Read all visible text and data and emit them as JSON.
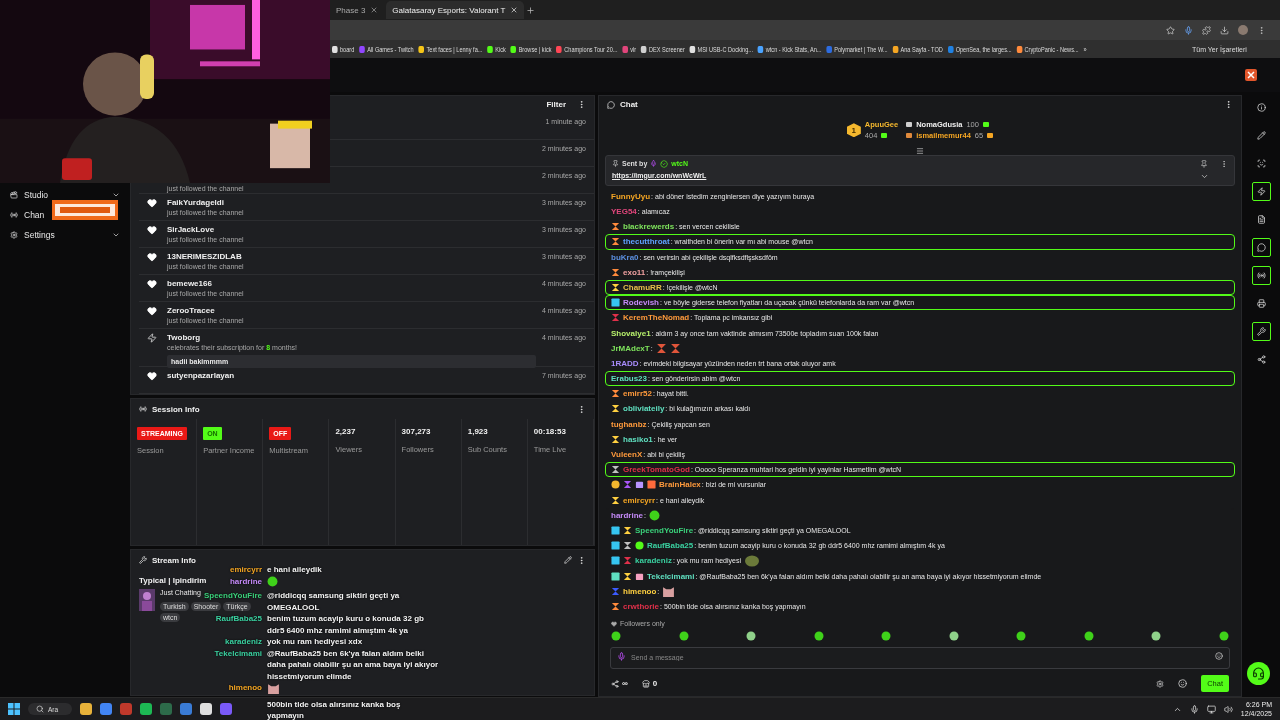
{
  "browser": {
    "tabs": [
      {
        "title": "Phase 3",
        "selected": false
      },
      {
        "title": "Galatasaray Esports: Valorant T",
        "selected": true
      }
    ],
    "bookmarks": [
      {
        "label": "board",
        "color": "#e0e0e0"
      },
      {
        "label": "All Games - Twitch",
        "color": "#9146ff"
      },
      {
        "label": "Text faces | Lenny fa...",
        "color": "#f5c518"
      },
      {
        "label": "Kick",
        "color": "#53fc18"
      },
      {
        "label": "Browse | kick",
        "color": "#53fc18"
      },
      {
        "label": "Champions Tour 20...",
        "color": "#ff4655"
      },
      {
        "label": "vlr",
        "color": "#e0457b"
      },
      {
        "label": "DEX Screener",
        "color": "#d0d0d0"
      },
      {
        "label": "MSI USB-C Docking...",
        "color": "#e0e0e0"
      },
      {
        "label": "wtcn - Kick Stats, An...",
        "color": "#4aa3ff"
      },
      {
        "label": "Polymarket | The W...",
        "color": "#2d6cdf"
      },
      {
        "label": "Ana Sayfa - TOD",
        "color": "#f5a623"
      },
      {
        "label": "OpenSea, the larges...",
        "color": "#2081e2"
      },
      {
        "label": "CryptoPanic - News...",
        "color": "#ff8a3c"
      }
    ],
    "bookmarks_more": "»",
    "all_bookmarks": "Tüm Yer İşaretleri"
  },
  "sidebar": {
    "items": [
      {
        "label": "Studio",
        "expandable": true
      },
      {
        "label": "Chan",
        "expandable": false
      },
      {
        "label": "Settings",
        "expandable": true
      }
    ]
  },
  "activity": {
    "filter": "Filter",
    "items": [
      {
        "time": "1 minute ago"
      },
      {
        "time": "2 minutes ago"
      },
      {
        "subtitle": "just followed the channel",
        "time": "2 minutes ago"
      },
      {
        "kind": "follow",
        "name": "FaikYurdageldi",
        "subtitle": "just followed the channel",
        "time": "3 minutes ago"
      },
      {
        "kind": "follow",
        "name": "SirJackLove",
        "subtitle": "just followed the channel",
        "time": "3 minutes ago"
      },
      {
        "kind": "follow",
        "name": "13NERIMESZIDLAB",
        "subtitle": "just followed the channel",
        "time": "3 minutes ago"
      },
      {
        "kind": "follow",
        "name": "bemewe166",
        "subtitle": "just followed the channel",
        "time": "4 minutes ago"
      },
      {
        "kind": "follow",
        "name": "ZerooTracee",
        "subtitle": "just followed the channel",
        "time": "4 minutes ago"
      },
      {
        "kind": "sub",
        "name": "Twoborg",
        "subtitle": "celebrates their subscription for ",
        "months": "8",
        "subtitle_end": " months!",
        "message": "hadii bakimmmm",
        "time": "4 minutes ago"
      },
      {
        "kind": "follow",
        "name": "sutyenpazarlayan",
        "time": "7 minutes ago"
      }
    ]
  },
  "session": {
    "title": "Session Info",
    "stats": [
      {
        "kind": "badge",
        "value": "STREAMING",
        "label": "Session",
        "color": "#e91916"
      },
      {
        "kind": "badge",
        "value": "ON",
        "label": "Partner Income",
        "color": "#53fc18"
      },
      {
        "kind": "badge",
        "value": "OFF",
        "label": "Multistream",
        "color": "#e91916"
      },
      {
        "kind": "number",
        "value": "2,237",
        "label": "Viewers"
      },
      {
        "kind": "number",
        "value": "307,273",
        "label": "Followers"
      },
      {
        "kind": "number",
        "value": "1,923",
        "label": "Sub Counts"
      },
      {
        "kind": "number",
        "value": "00:18:53",
        "label": "Time Live"
      }
    ]
  },
  "stream_info": {
    "title": "Stream Info",
    "stream_title": "Typical | Ipindirim",
    "category": "Just Chatting",
    "tags": [
      "Turkish",
      "Shooter",
      "Türkçe",
      "wtcn"
    ]
  },
  "overlay_chat": [
    {
      "name": "emircyrr",
      "color": "#f5a623",
      "text": "e hani aileydik"
    },
    {
      "name": "hardrine",
      "color": "#c58af9",
      "emotes": [
        {
          "kind": "blob"
        }
      ]
    },
    {
      "name": "SpeendYouFire",
      "color": "#3ad07a",
      "text": "@riddicqq samsung siktiri geçti ya OMEGALOOL"
    },
    {
      "name": "RaufBaba25",
      "color": "#3ad0a0",
      "text": "benim tuzum acayip kuru o konuda 32 gb ddr5 6400 mhz ramimi almıştım 4k ya"
    },
    {
      "name": "karadeniz",
      "color": "#3ad0a0",
      "text": "yok mu ram hediyesi xdx"
    },
    {
      "name": "Tekelcimami",
      "color": "#3ad0a0",
      "text": "@RaufBaba25 ben 6k'ya falan aldım belki daha pahalı olabilir şu an ama baya iyi akıyor hissetmiyorum elimde"
    },
    {
      "name": "himenoo",
      "color": "#f5a623",
      "emotes": [
        {
          "kind": "cat"
        }
      ]
    },
    {
      "text": "500bin tlde olsa alırsınız kanka boş yapmayın"
    }
  ],
  "chat": {
    "title": "Chat",
    "leaderboard": [
      {
        "rank": "1",
        "name": "ApuuGee",
        "points": "404"
      },
      {
        "name": "NomaGdusia",
        "points": "100"
      },
      {
        "name": "ismailmemur44",
        "points": "65"
      }
    ],
    "pinned": {
      "label": "Sent by",
      "user": "wtcN",
      "link": "https://imgur.com/wnWcWrL"
    },
    "messages": [
      {
        "name": "FunnyUyu",
        "color": "#f5a623",
        "text": ": abi döner istedim zenginlersen diye yazıyım buraya",
        "highlighted": false
      },
      {
        "name": "YEG54",
        "color": "#e0457b",
        "text": ": alamıcaz",
        "highlighted": false
      },
      {
        "badges": [
          {
            "kind": "sub",
            "color": "#ff8a3c"
          }
        ],
        "name": "blackrewerds",
        "color": "#7ee35c",
        "text": ": sen vercen cekilisle",
        "highlighted": false
      },
      {
        "badges": [
          {
            "kind": "sub",
            "color": "#ff8a3c"
          }
        ],
        "name": "thecutthroat",
        "color": "#5fa0ff",
        "text": ": wraithden bi önerin var mı abi mouse @wtcn",
        "highlighted": true
      },
      {
        "name": "buKra0",
        "color": "#5b8fe0",
        "text": ": sen verirsin abi çekilişle dsqlfksdflşsksdföm",
        "highlighted": false
      },
      {
        "badges": [
          {
            "kind": "sub",
            "color": "#ff8a3c"
          }
        ],
        "name": "exo11",
        "color": "#f0a0a0",
        "text": ": !ramçekilişi",
        "highlighted": false
      },
      {
        "badges": [
          {
            "kind": "sub",
            "color": "#ffd040"
          }
        ],
        "name": "ChamuRR",
        "color": "#e8c04a",
        "text": ": !çekilişle @wtcN",
        "highlighted": true
      },
      {
        "badges": [
          {
            "kind": "og",
            "color": "#36c5f0"
          }
        ],
        "name": "Rodevish",
        "color": "#c58af9",
        "text": ": ve böyle giderse telefon fiyatları da uçacak çünkü telefonlarda da ram var @wtcn",
        "highlighted": true
      },
      {
        "badges": [
          {
            "kind": "sub",
            "color": "#e0304a"
          }
        ],
        "name": "KeremTheNomad",
        "color": "#ff9a3c",
        "text": ": Toplama pc imkansız gibi",
        "highlighted": false
      },
      {
        "name": "Shovalye1",
        "color": "#b7f06c",
        "text": ": aldım 3 ay once tam vaktinde almısım 73500e topladım suan 100k falan",
        "highlighted": false
      },
      {
        "name": "JrMAdexT",
        "color": "#7ee35c",
        "text": ":",
        "emotes": [
          {
            "kind": "hourglass"
          },
          {
            "kind": "hourglass"
          }
        ],
        "highlighted": false
      },
      {
        "name": "1RADD",
        "color": "#a78bfa",
        "text": ": evimdeki bilgisayar yüzünden neden trt bana ortak oluyor amk",
        "highlighted": false
      },
      {
        "name": "Erabus23",
        "color": "#5fe0c0",
        "text": ": sen gönderirsin abim @wtcn",
        "highlighted": true
      },
      {
        "badges": [
          {
            "kind": "sub",
            "color": "#ff8a3c"
          }
        ],
        "name": "emirr52",
        "color": "#ff9a3c",
        "text": ": hayat bitti.",
        "highlighted": false
      },
      {
        "badges": [
          {
            "kind": "sub",
            "color": "#ffd040"
          }
        ],
        "name": "obliviateily",
        "color": "#5fe0c0",
        "text": ": bi kulağımızın arkası kaldı",
        "highlighted": false
      },
      {
        "name": "tughanbz",
        "color": "#ff9a3c",
        "text": ": Çekiliş yapcan sen",
        "highlighted": false
      },
      {
        "badges": [
          {
            "kind": "sub",
            "color": "#ffd040"
          }
        ],
        "name": "hasiko1",
        "color": "#5fe0c0",
        "text": ": he ver",
        "highlighted": false
      },
      {
        "name": "VuleenX",
        "color": "#ff9a3c",
        "text": ": abi bi çekiliş",
        "highlighted": false
      },
      {
        "badges": [
          {
            "kind": "sub",
            "color": "#c0c0c0"
          }
        ],
        "name": "GreekTomatoGod",
        "color": "#e0304a",
        "text": ": Ooooo Speranza muhtari hos geldin iyi yayinlar Hasmetlim @wtcN",
        "highlighted": true
      },
      {
        "badges": [
          {
            "kind": "rank",
            "color": "#f5b82e"
          },
          {
            "kind": "sub",
            "color": "#a855f7"
          },
          {
            "kind": "gift",
            "color": "#b894ff"
          },
          {
            "kind": "og",
            "color": "#ff6b3c"
          }
        ],
        "name": "BrainHalex",
        "color": "#ff9a3c",
        "text": ": bizi de mi vursunlar",
        "highlighted": false
      },
      {
        "badges": [
          {
            "kind": "sub",
            "color": "#ffd040"
          }
        ],
        "name": "emircyrr",
        "color": "#f5a623",
        "text": ": e hani aileydik",
        "highlighted": false
      },
      {
        "name": "hardrine",
        "color": "#c58af9",
        "text": ":",
        "emotes": [
          {
            "kind": "blob"
          }
        ],
        "highlighted": false
      },
      {
        "badges": [
          {
            "kind": "og",
            "color": "#36c5f0"
          },
          {
            "kind": "sub",
            "color": "#ffd040"
          }
        ],
        "name": "SpeendYouFire",
        "color": "#3ad07a",
        "text": ": @riddicqq samsung siktiri geçti ya OMEGALOOL",
        "highlighted": false
      },
      {
        "badges": [
          {
            "kind": "og",
            "color": "#36c5f0"
          },
          {
            "kind": "sub",
            "color": "#c0c0c0"
          },
          {
            "kind": "verified",
            "color": "#53fc18"
          }
        ],
        "name": "RaufBaba25",
        "color": "#3ad0a0",
        "text": ": benim tuzum acayip kuru o konuda 32 gb ddr5 6400 mhz ramimi almıştım 4k ya",
        "highlighted": false
      },
      {
        "badges": [
          {
            "kind": "og",
            "color": "#36c5f0"
          },
          {
            "kind": "sub",
            "color": "#e0304a"
          }
        ],
        "name": "karadeniz",
        "color": "#3ad0a0",
        "text": ": yok mu ram hediyesi",
        "emotes": [
          {
            "kind": "frog"
          }
        ],
        "highlighted": false
      },
      {
        "badges": [
          {
            "kind": "og",
            "color": "#5fe0c0"
          },
          {
            "kind": "sub",
            "color": "#ffd040"
          },
          {
            "kind": "gift",
            "color": "#f5a0c0"
          }
        ],
        "name": "Tekelcimami",
        "color": "#5fe0c0",
        "text": ": @RaufBaba25 ben 6k'ya falan aldım belki daha pahalı olabilir şu an ama baya iyi akıyor hissetmiyorum elimde",
        "highlighted": false
      },
      {
        "badges": [
          {
            "kind": "sub",
            "color": "#3b5bff"
          }
        ],
        "name": "himenoo",
        "color": "#ffd040",
        "text": ":",
        "emotes": [
          {
            "kind": "cat"
          }
        ],
        "highlighted": false
      },
      {
        "badges": [
          {
            "kind": "sub",
            "color": "#ff8a3c"
          }
        ],
        "name": "crwthorie",
        "color": "#e0304a",
        "text": ": 500bin tlde olsa alırsınız kanka boş yapmayın",
        "highlighted": false
      }
    ],
    "mode": "Followers only",
    "placeholder": "Send a message",
    "points": "∞",
    "store_count": "0",
    "send": "Chat"
  },
  "rail": [
    {
      "kind": "info",
      "highlighted": false
    },
    {
      "kind": "pencil",
      "highlighted": false
    },
    {
      "kind": "scan",
      "highlighted": false
    },
    {
      "kind": "zap",
      "highlighted": true
    },
    {
      "kind": "file",
      "highlighted": false
    },
    {
      "kind": "chat",
      "highlighted": true
    },
    {
      "kind": "radio",
      "highlighted": true
    },
    {
      "kind": "printer",
      "highlighted": false
    },
    {
      "kind": "wrench",
      "highlighted": true
    },
    {
      "kind": "nodes",
      "highlighted": false
    }
  ],
  "taskbar": {
    "search": "Ara",
    "time": "6:26 PM",
    "date": "12/4/2025"
  }
}
